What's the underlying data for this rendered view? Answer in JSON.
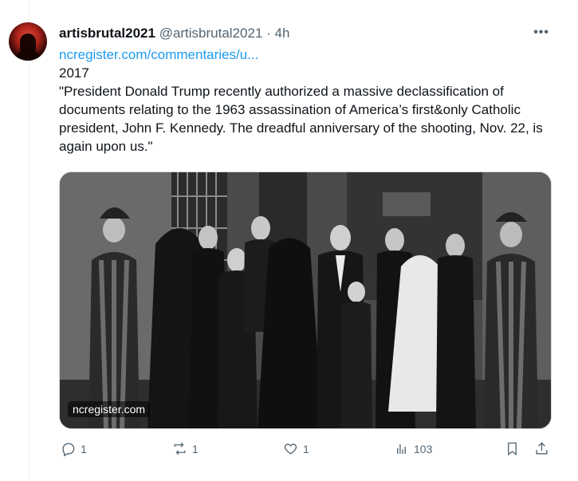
{
  "author": {
    "display_name": "artisbrutal2021",
    "handle": "@artisbrutal2021",
    "separator": "·",
    "time": "4h",
    "more_icon": "more-horizontal-icon"
  },
  "post": {
    "link": "ncregister.com/commentaries/u...",
    "year": "2017",
    "text": "\"President Donald Trump recently authorized a massive declassification of documents relating to the 1963 assassination of America’s first&only Catholic president, John F. Kennedy. The dreadful anniversary of  the shooting, Nov. 22, is again upon us.\""
  },
  "media": {
    "source_label": "ncregister.com"
  },
  "actions": {
    "replies": "1",
    "reposts": "1",
    "likes": "1",
    "views": "103"
  },
  "colors": {
    "link": "#1d9bf0",
    "secondary_text": "#536471",
    "border": "#cfd9de"
  }
}
